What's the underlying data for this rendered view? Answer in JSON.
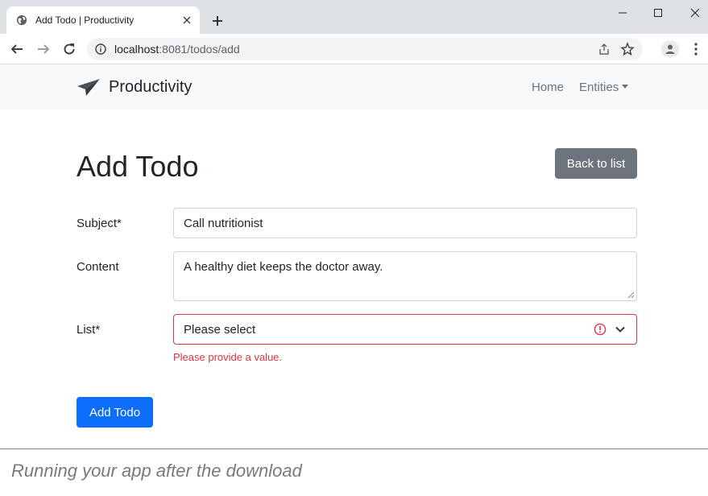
{
  "browser": {
    "tab_title": "Add Todo | Productivity",
    "url_host": "localhost",
    "url_rest": ":8081/todos/add"
  },
  "navbar": {
    "brand": "Productivity",
    "links": {
      "home": "Home",
      "entities": "Entities"
    }
  },
  "page": {
    "title": "Add Todo",
    "back_button": "Back to list"
  },
  "form": {
    "subject": {
      "label": "Subject*",
      "value": "Call nutritionist"
    },
    "content": {
      "label": "Content",
      "value": "A healthy diet keeps the doctor away."
    },
    "list": {
      "label": "List*",
      "selected": "Please select",
      "error": "Please provide a value."
    },
    "submit": "Add Todo"
  },
  "caption": "Running your app after the download",
  "colors": {
    "primary": "#0d6efd",
    "secondary": "#6c757d",
    "danger": "#dc3545",
    "navbar_bg": "#f8f9fa"
  }
}
